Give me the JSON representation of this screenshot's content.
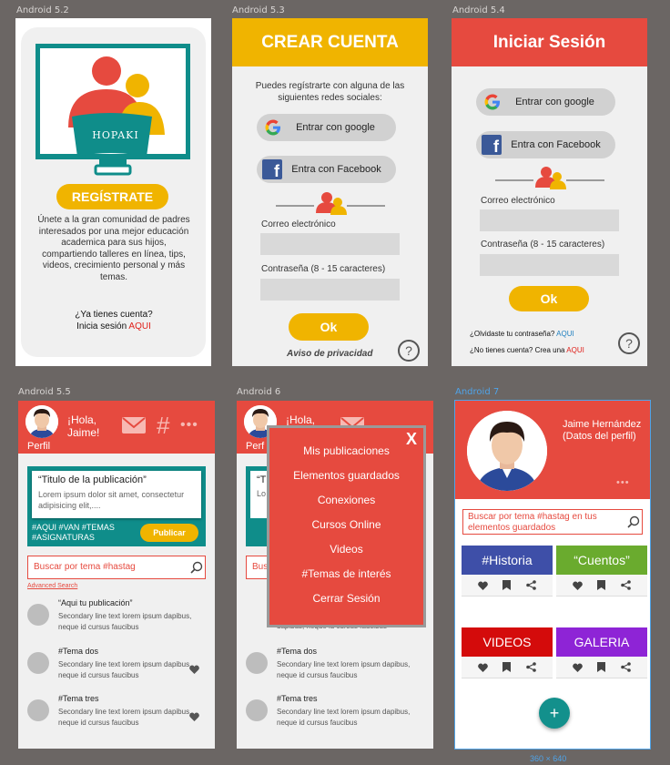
{
  "frames": {
    "f1": "Android 5.2",
    "f2": "Android 5.3",
    "f3": "Android 5.4",
    "f4": "Android 5.5",
    "f5": "Android 6",
    "f6": "Android 7"
  },
  "size_label": "360 × 640",
  "screen1": {
    "logo_text": "HOPAKI",
    "register_button": "REGÍSTRATE",
    "description": "Únete a la gran comunidad de padres interesados por una mejor educación academica para sus hijos, compartiendo talleres en línea, tips, videos, crecimiento personal y más temas.",
    "have_account": "¿Ya tienes cuenta?",
    "login_prefix": "Inicia sesión",
    "login_link": "AQUI"
  },
  "screen2": {
    "title": "CREAR CUENTA",
    "intro": "Puedes regístrarte con alguna de las siguientes redes sociales:",
    "google_button": "Entrar con google",
    "facebook_button": "Entra con Facebook",
    "email_label": "Correo electrónico",
    "password_label": "Contraseña (8 - 15 caracteres)",
    "ok_button": "Ok",
    "privacy": "Aviso de privacidad",
    "help_icon": "?"
  },
  "screen3": {
    "title": "Iniciar Sesión",
    "google_button": "Entrar con google",
    "facebook_button": "Entra con Facebook",
    "email_label": "Correo electrónico",
    "password_label": "Contraseña (8 - 15 caracteres)",
    "ok_button": "Ok",
    "forgot_prefix": "¿Olvidaste tu contraseña?",
    "forgot_link": "AQUI",
    "no_account_prefix": "¿No tienes cuenta? Crea una",
    "no_account_link": "AQUI",
    "help_icon": "?"
  },
  "screen4": {
    "greeting": "¡Hola, Jaime!",
    "profile_label": "Perfil",
    "hash_icon": "#",
    "dots": "•••",
    "post_title": "“Titulo de la publicación”",
    "post_body": "Lorem ipsum dolor sit amet, consectetur adipisicing elit,....",
    "post_tags": "#AQUI #VAN #TEMAS #ASIGNATURAS",
    "publish_button": "Publicar",
    "search_placeholder": "Buscar por tema #hastag",
    "advanced_search": "Advanced Search",
    "items": [
      {
        "title": "“Aqui tu publicación”",
        "sub": "Secondary line text lorem ipsum dapibus, neque id cursus faucibus"
      },
      {
        "title": "#Tema dos",
        "sub": "Secondary line text lorem ipsum dapibus, neque id cursus faucibus"
      },
      {
        "title": "#Tema tres",
        "sub": "Secondary line text lorem ipsum dapibus, neque id cursus faucibus"
      }
    ]
  },
  "screen5": {
    "greeting": "¡Hola,",
    "profile_label": "Perf",
    "partial_title": "“T",
    "partial_body": "Lo",
    "partial_search": "Bus",
    "partial_sub": "dapibus, neque id cursus faucibus",
    "close": "X",
    "menu": [
      "Mis publicaciones",
      "Elementos guardados",
      "Conexiones",
      "Cursos Online",
      "Videos",
      "#Temas de interés",
      "Cerrar Sesión"
    ],
    "items": [
      {
        "title": "#Tema dos",
        "sub": "Secondary line text lorem ipsum dapibus, neque id cursus faucibus"
      },
      {
        "title": "#Tema tres",
        "sub": "Secondary line text lorem ipsum dapibus, neque id cursus faucibus"
      }
    ]
  },
  "screen6": {
    "name": "Jaime Hernández (Datos del perfil)",
    "dots": "•••",
    "search_placeholder": "Buscar por tema #hastag en tus elementos guardados",
    "tiles": [
      {
        "label": "#Historia",
        "color": "#3e4fa8"
      },
      {
        "label": "“Cuentos”",
        "color": "#6aab2e"
      },
      {
        "label": "VIDEOS",
        "color": "#d40b0b"
      },
      {
        "label": "GALERIA",
        "color": "#8e24d6"
      }
    ],
    "fab": "+"
  },
  "colors": {
    "red": "#e64a3f",
    "yellow": "#f0b400",
    "teal": "#0f8d8a"
  }
}
